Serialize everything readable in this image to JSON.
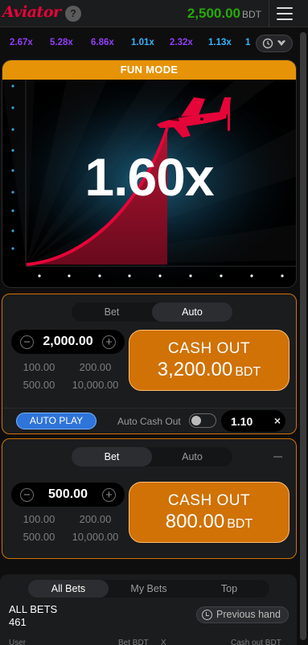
{
  "header": {
    "logo_text": "Aviator",
    "help_label": "?",
    "balance": "2,500.00",
    "currency": "BDT"
  },
  "history": [
    {
      "value": "2.67x",
      "color": "#913ef8"
    },
    {
      "value": "5.28x",
      "color": "#913ef8"
    },
    {
      "value": "6.86x",
      "color": "#913ef8"
    },
    {
      "value": "1.01x",
      "color": "#34b4ff"
    },
    {
      "value": "2.32x",
      "color": "#913ef8"
    },
    {
      "value": "1.13x",
      "color": "#34b4ff"
    },
    {
      "value": "1",
      "color": "#34b4ff"
    }
  ],
  "game": {
    "mode_banner": "FUN MODE",
    "multiplier": "1.60x"
  },
  "bet1": {
    "tabs": [
      "Bet",
      "Auto"
    ],
    "active_tab": "Auto",
    "stake": "2,000.00",
    "quick_amounts": [
      "100.00",
      "200.00",
      "500.00",
      "10,000.00"
    ],
    "cashout_label": "CASH OUT",
    "cashout_amount": "3,200.00",
    "cashout_currency": "BDT",
    "auto_play_label": "AUTO PLAY",
    "auto_cashout_label": "Auto Cash Out",
    "auto_cashout_value": "1.10",
    "auto_cashout_clear": "×"
  },
  "bet2": {
    "tabs": [
      "Bet",
      "Auto"
    ],
    "active_tab": "Bet",
    "stake": "500.00",
    "quick_amounts": [
      "100.00",
      "200.00",
      "500.00",
      "10,000.00"
    ],
    "cashout_label": "CASH OUT",
    "cashout_amount": "800.00",
    "cashout_currency": "BDT"
  },
  "all_bets": {
    "tabs": [
      "All Bets",
      "My Bets",
      "Top"
    ],
    "active_tab": "All Bets",
    "title": "ALL BETS",
    "count": "461",
    "previous_hand_label": "Previous hand",
    "columns": [
      "User",
      "Bet BDT",
      "X",
      "Cash out BDT"
    ]
  },
  "colors": {
    "accent_orange": "#d07206",
    "balance_green": "#28a909",
    "logo_red": "#e50539",
    "plane_red": "#e50539",
    "auto_play_blue": "#2e74d9"
  }
}
